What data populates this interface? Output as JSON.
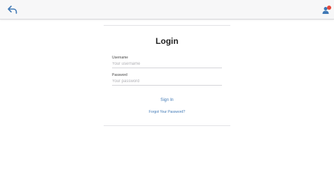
{
  "header": {
    "back_icon": "back-arrow-icon",
    "user_icon": "user-icon",
    "accent_color": "#3f78b5",
    "badge_color": "#e5473a"
  },
  "login": {
    "title": "Login",
    "username_label": "Username",
    "username_placeholder": "Your username",
    "username_value": "",
    "password_label": "Password",
    "password_placeholder": "Your password",
    "password_value": "",
    "signin_label": "Sign In",
    "forgot_label": "Forgot Your Password?"
  }
}
